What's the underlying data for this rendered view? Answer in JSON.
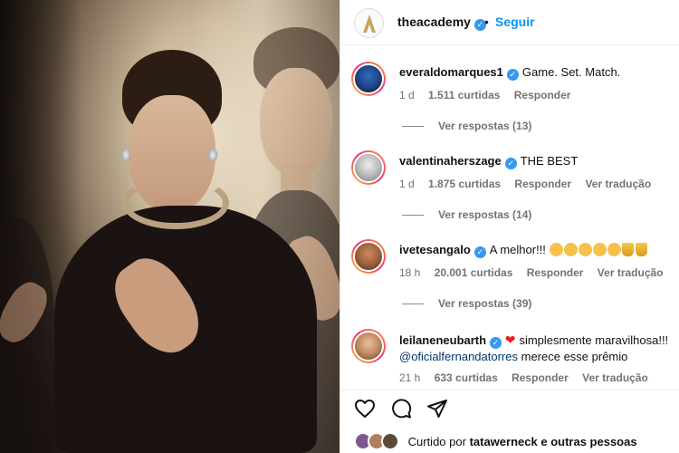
{
  "header": {
    "account": "theacademy",
    "separator": "•",
    "follow_label": "Seguir"
  },
  "comments": [
    {
      "username": "everaldomarques1",
      "text": "Game. Set. Match.",
      "time": "1 d",
      "likes": "1.511 curtidas",
      "reply_label": "Responder",
      "view_replies": "Ver respostas (13)"
    },
    {
      "username": "valentinaherszage",
      "text": "THE BEST",
      "time": "1 d",
      "likes": "1.875 curtidas",
      "reply_label": "Responder",
      "translate_label": "Ver tradução",
      "view_replies": "Ver respostas (14)"
    },
    {
      "username": "ivetesangalo",
      "text": "A melhor!!!",
      "time": "18 h",
      "likes": "20.001 curtidas",
      "reply_label": "Responder",
      "translate_label": "Ver tradução",
      "view_replies": "Ver respostas (39)"
    },
    {
      "username": "leilaneneubarth",
      "text": "simplesmente maravilhosa!!!",
      "mention": "@oficialfernandatorres",
      "text2": "merece esse prêmio",
      "time": "21 h",
      "likes": "633 curtidas",
      "reply_label": "Responder",
      "translate_label": "Ver tradução"
    }
  ],
  "footer": {
    "liked_prefix": "Curtido por",
    "liked_user": "tatawerneck",
    "liked_conj": "e",
    "liked_others": "outras pessoas"
  },
  "icons": [
    "academy-logo-icon",
    "verified-icon",
    "heart-icon",
    "comment-icon",
    "share-icon"
  ],
  "colors": {
    "accent": "#0095f6",
    "verified": "#3897f0",
    "muted": "#737373"
  }
}
